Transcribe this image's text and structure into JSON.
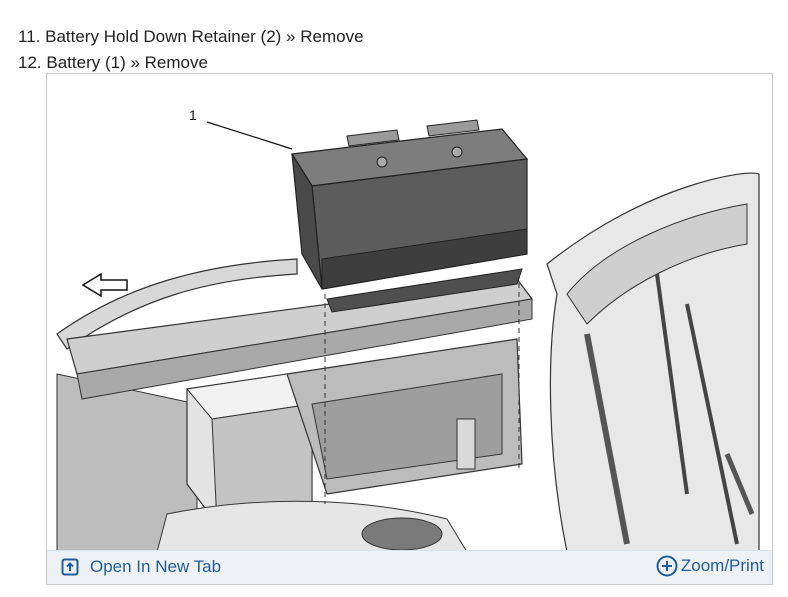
{
  "steps": [
    {
      "number": "11.",
      "text": "Battery Hold Down Retainer (2) » Remove"
    },
    {
      "number": "12.",
      "text": "Battery (1) » Remove"
    }
  ],
  "figure": {
    "callout_label": "1",
    "illustration_subject": "battery removal from engine compartment tray"
  },
  "toolbar": {
    "open_tab_label": "Open In New Tab",
    "open_tab_icon": "open-new-tab-icon",
    "zoom_label": "Zoom/Print",
    "zoom_icon": "plus-circle-icon"
  },
  "colors": {
    "link": "#1f5c99",
    "toolbar_bg": "#eef2f6",
    "frame_border": "#c9c9c9"
  }
}
